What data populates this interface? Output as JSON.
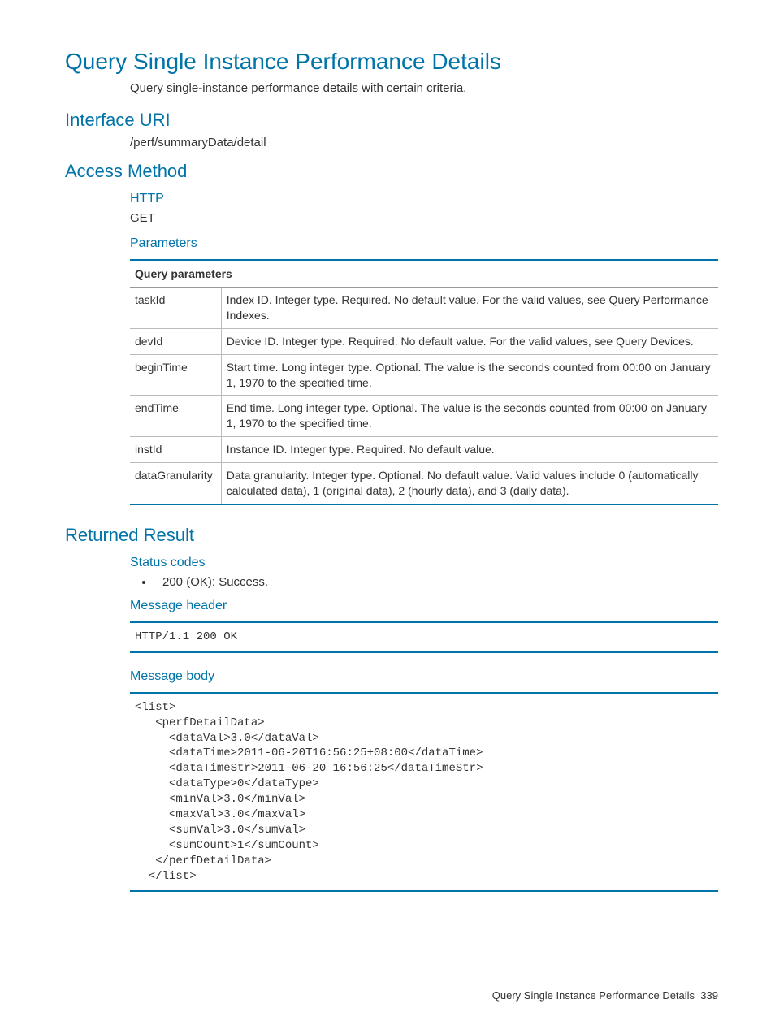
{
  "title": "Query Single Instance Performance Details",
  "description": "Query single-instance performance details with certain criteria.",
  "interface_uri": {
    "heading": "Interface URI",
    "value": "/perf/summaryData/detail"
  },
  "access_method": {
    "heading": "Access Method",
    "http_heading": "HTTP",
    "http_value": "GET",
    "parameters_heading": "Parameters",
    "table_header": "Query parameters",
    "params": [
      {
        "name": "taskId",
        "desc": "Index ID. Integer type. Required. No default value. For the valid values, see Query Performance Indexes."
      },
      {
        "name": "devId",
        "desc": "Device ID. Integer type. Required. No default value. For the valid values, see Query Devices."
      },
      {
        "name": "beginTime",
        "desc": "Start time. Long integer type. Optional. The value is the seconds counted from 00:00 on January 1, 1970 to the specified time."
      },
      {
        "name": "endTime",
        "desc": "End time. Long integer type. Optional. The value is the seconds counted from 00:00 on January 1, 1970 to the specified time."
      },
      {
        "name": "instId",
        "desc": "Instance ID. Integer type. Required. No default value."
      },
      {
        "name": "dataGranularity",
        "desc": "Data granularity. Integer type. Optional. No default value. Valid values include 0 (automatically calculated data), 1 (original data), 2 (hourly data), and 3 (daily data)."
      }
    ]
  },
  "returned_result": {
    "heading": "Returned Result",
    "status_codes_heading": "Status codes",
    "status_code_item": "200 (OK): Success.",
    "message_header_heading": "Message header",
    "message_header_code": "HTTP/1.1 200 OK",
    "message_body_heading": "Message body",
    "message_body_code": "<list>\n   <perfDetailData>\n     <dataVal>3.0</dataVal>\n     <dataTime>2011-06-20T16:56:25+08:00</dataTime>\n     <dataTimeStr>2011-06-20 16:56:25</dataTimeStr>\n     <dataType>0</dataType>\n     <minVal>3.0</minVal>\n     <maxVal>3.0</maxVal>\n     <sumVal>3.0</sumVal>\n     <sumCount>1</sumCount>\n   </perfDetailData>\n  </list>"
  },
  "footer": {
    "label": "Query Single Instance Performance Details",
    "page": "339"
  }
}
